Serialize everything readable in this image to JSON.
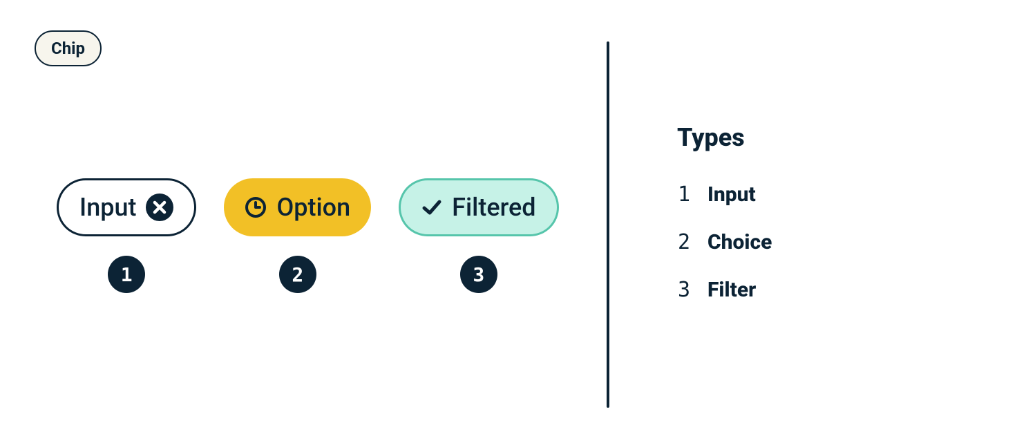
{
  "header": {
    "pill_label": "Chip"
  },
  "examples": [
    {
      "badge": "1",
      "chip_label": "Input",
      "variant": "input",
      "icon": "close",
      "icon_pos": "trailing"
    },
    {
      "badge": "2",
      "chip_label": "Option",
      "variant": "option",
      "icon": "clock",
      "icon_pos": "leading"
    },
    {
      "badge": "3",
      "chip_label": "Filtered",
      "variant": "filtered",
      "icon": "check",
      "icon_pos": "leading"
    }
  ],
  "legend": {
    "title": "Types",
    "items": [
      {
        "num": "1",
        "label": "Input"
      },
      {
        "num": "2",
        "label": "Choice"
      },
      {
        "num": "3",
        "label": "Filter"
      }
    ]
  },
  "colors": {
    "ink": "#0c2335",
    "cream": "#f7f5ed",
    "gold": "#f2c026",
    "mint": "#c6f2e7",
    "mint_border": "#56c5ab"
  }
}
